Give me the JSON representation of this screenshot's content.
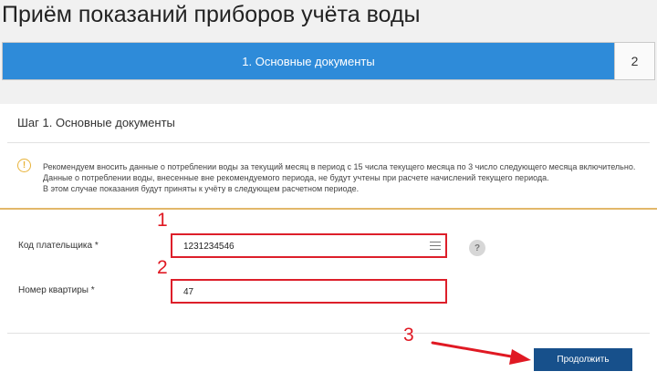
{
  "page": {
    "title": "Приём показаний приборов учёта воды"
  },
  "stepper": {
    "active_label": "1. Основные документы",
    "next_label": "2"
  },
  "card": {
    "title": "Шаг 1. Основные документы",
    "notice": {
      "icon": "exclamation-icon",
      "lines": [
        "Рекомендуем вносить данные о потреблении воды за текущий месяц в период с 15 числа текущего месяца по 3 число следующего месяца включительно.",
        "Данные о потреблении воды, внесенные вне рекомендуемого периода, не будут учтены при расчете начислений текущего периода.",
        "В этом случае показания будут приняты к учёту в следующем расчетном периоде."
      ]
    }
  },
  "form": {
    "payer_code": {
      "label": "Код плательщика",
      "required_mark": "*",
      "value": "1231234546"
    },
    "apartment": {
      "label": "Номер квартиры",
      "required_mark": "*",
      "value": "47"
    },
    "help": {
      "label": "?"
    },
    "continue_label": "Продолжить"
  },
  "annotations": [
    "1",
    "2",
    "3"
  ],
  "colors": {
    "accent": "#2e8bd9",
    "button": "#17508b",
    "highlight": "#dd1f2a",
    "warning": "#e8b33a"
  }
}
